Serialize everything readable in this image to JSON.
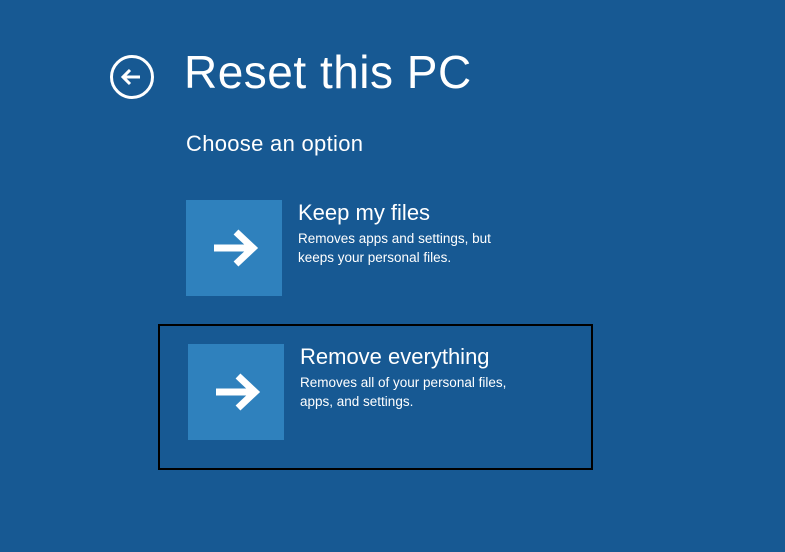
{
  "header": {
    "title": "Reset this PC"
  },
  "subtitle": "Choose an option",
  "options": [
    {
      "title": "Keep my files",
      "description": "Removes apps and settings, but keeps your personal files."
    },
    {
      "title": "Remove everything",
      "description": "Removes all of your personal files, apps, and settings."
    }
  ]
}
